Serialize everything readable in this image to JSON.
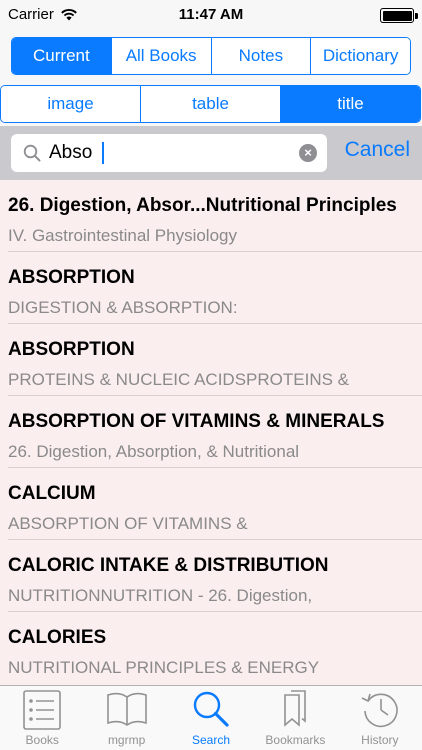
{
  "status_bar": {
    "carrier": "Carrier",
    "time": "11:47 AM"
  },
  "top_segments": [
    {
      "label": "Current",
      "active": true
    },
    {
      "label": "All Books",
      "active": false
    },
    {
      "label": "Notes",
      "active": false
    },
    {
      "label": "Dictionary",
      "active": false
    }
  ],
  "scope_segments": [
    {
      "label": "image",
      "active": false
    },
    {
      "label": "table",
      "active": false
    },
    {
      "label": "title",
      "active": true
    }
  ],
  "search": {
    "value": "Abso",
    "cancel_label": "Cancel",
    "icon": "search-icon",
    "clear_icon": "clear-icon"
  },
  "results": [
    {
      "title": "26. Digestion, Absor...Nutritional Principles",
      "subtitle": "IV. Gastrointestinal Physiology"
    },
    {
      "title": "ABSORPTION",
      "subtitle": "DIGESTION & ABSORPTION:"
    },
    {
      "title": "ABSORPTION",
      "subtitle": "PROTEINS & NUCLEIC ACIDSPROTEINS &"
    },
    {
      "title": "ABSORPTION OF VITAMINS & MINERALS",
      "subtitle": "26. Digestion, Absorption, & Nutritional"
    },
    {
      "title": "CALCIUM",
      "subtitle": "ABSORPTION OF VITAMINS &"
    },
    {
      "title": "CALORIC INTAKE & DISTRIBUTION",
      "subtitle": "NUTRITIONNUTRITION - 26. Digestion,"
    },
    {
      "title": "CALORIES",
      "subtitle": "NUTRITIONAL PRINCIPLES & ENERGY"
    }
  ],
  "tabs": [
    {
      "label": "Books",
      "icon": "list-icon",
      "active": false
    },
    {
      "label": "mgrmp",
      "icon": "open-book-icon",
      "active": false
    },
    {
      "label": "Search",
      "icon": "search-icon",
      "active": true
    },
    {
      "label": "Bookmarks",
      "icon": "bookmarks-icon",
      "active": false
    },
    {
      "label": "History",
      "icon": "history-clock-icon",
      "active": false
    }
  ],
  "colors": {
    "accent": "#0a7bff",
    "list_background": "#fbeeee",
    "subtitle": "#8a8a8a"
  }
}
